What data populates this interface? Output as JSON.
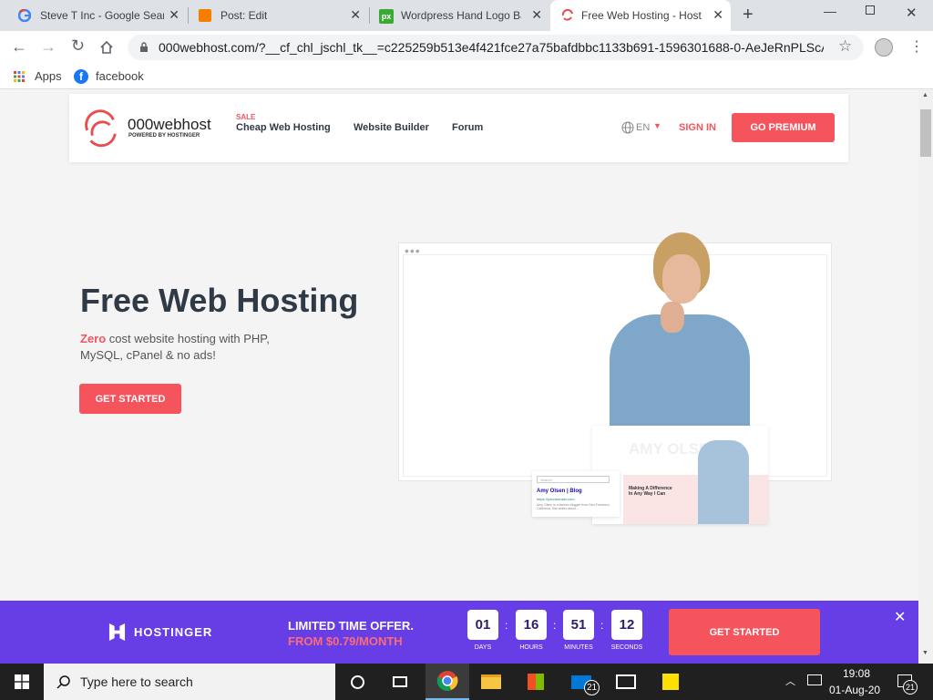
{
  "browser": {
    "tabs": [
      {
        "label": "Steve T Inc - Google Sear",
        "icon": "google-icon"
      },
      {
        "label": "Post: Edit",
        "icon": "blogger-icon"
      },
      {
        "label": "Wordpress Hand Logo Ba",
        "icon": "pixlr-icon"
      },
      {
        "label": "Free Web Hosting - Host",
        "icon": "000webhost-icon"
      }
    ],
    "url": "000webhost.com/?__cf_chl_jschl_tk__=c225259b513e4f421fce27a75bafdbbc1133b691-1596301688-0-AeJeRnPLScAe...",
    "bookmarks": [
      {
        "label": "Apps"
      },
      {
        "label": "facebook"
      }
    ]
  },
  "nav": {
    "logo_text": "000webhost",
    "logo_sub": "POWERED BY HOSTINGER",
    "sale_badge": "SALE",
    "links": [
      "Cheap Web Hosting",
      "Website Builder",
      "Forum"
    ],
    "lang": "EN",
    "sign_in": "SIGN IN",
    "go_premium": "GO PREMIUM"
  },
  "hero": {
    "title": "Free Web Hosting",
    "sub_highlight": "Zero",
    "sub_rest": " cost website hosting with PHP, MySQL, cPanel & no ads!",
    "cta": "GET STARTED"
  },
  "mockup": {
    "blog_name": "Amy Olsen",
    "blog_word": "Blog",
    "blog_url": "https://yourdomain.com",
    "blog_desc": "Amy Olsen is a fashion blogger from San Francisco, California. She writes about...",
    "search_placeholder": "Search",
    "site_heading": "AMY OLSEN",
    "card_title": "Making A Difference In Any Way I Can"
  },
  "promo": {
    "brand": "HOSTINGER",
    "line1": "LIMITED TIME OFFER.",
    "line2": "FROM $0.79/MONTH",
    "days": "01",
    "hours": "16",
    "minutes": "51",
    "seconds": "12",
    "days_lbl": "DAYS",
    "hours_lbl": "HOURS",
    "minutes_lbl": "MINUTES",
    "seconds_lbl": "SECONDS",
    "cta": "GET STARTED"
  },
  "taskbar": {
    "search_placeholder": "Type here to search",
    "time": "19:08",
    "date": "01-Aug-20",
    "mail_badge": "21",
    "notif_badge": "21"
  },
  "colors": {
    "accent": "#f6545d",
    "promo": "#673de6",
    "dark_text": "#2f3a46"
  }
}
